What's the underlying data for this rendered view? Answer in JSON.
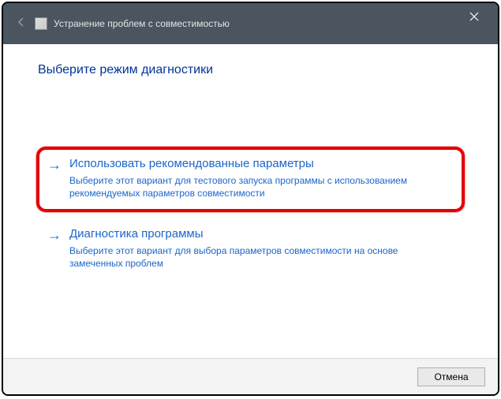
{
  "titlebar": {
    "title": "Устранение проблем с совместимостью"
  },
  "content": {
    "heading": "Выберите режим диагностики",
    "options": [
      {
        "title": "Использовать рекомендованные параметры",
        "description": "Выберите этот вариант для тестового запуска программы с использованием рекомендуемых параметров совместимости"
      },
      {
        "title": "Диагностика программы",
        "description": "Выберите этот вариант для выбора параметров совместимости на основе замеченных проблем"
      }
    ]
  },
  "footer": {
    "cancel_label": "Отмена"
  }
}
